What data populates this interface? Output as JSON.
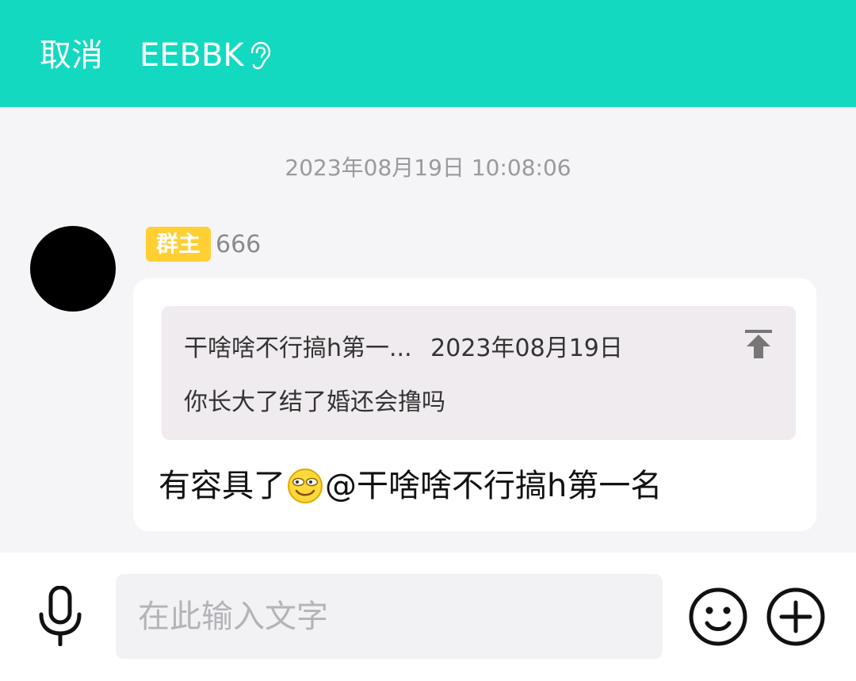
{
  "header": {
    "cancel_label": "取消",
    "title": "EEBBK",
    "icon": "ear-icon",
    "background_color": "#13d9c0"
  },
  "chat": {
    "timestamp": "2023年08月19日 10:08:06",
    "message": {
      "role_badge": "群主",
      "sender_name": "666",
      "quote": {
        "author": "干啥啥不行搞h第一...",
        "date": "2023年08月19日",
        "text": "你长大了结了婚还会撸吗",
        "icon": "pin-to-top-icon"
      },
      "text_before_emoji": "有容具了",
      "emoji": "smirk-face-emoji",
      "text_after_emoji": "@干啥啥不行搞h第一名"
    }
  },
  "footer": {
    "input_placeholder": "在此输入文字",
    "icons": [
      "microphone-icon",
      "smile-icon",
      "plus-icon"
    ]
  },
  "colors": {
    "accent": "#13d9c0",
    "badge": "#ffcf33",
    "chat_background": "#f5f5f8",
    "quote_background": "#efebee"
  }
}
